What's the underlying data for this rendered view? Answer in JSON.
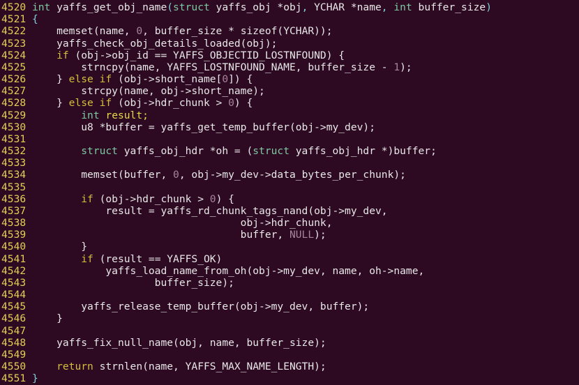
{
  "colors": {
    "background": "#2d0922",
    "line_number": "#e3cf55",
    "keyword": "#d4bf3c",
    "type": "#7ec8a2",
    "number": "#a8849c",
    "match": "#7fd0dc",
    "text": "#e8e8e8"
  },
  "lines": [
    {
      "num": "4520",
      "segs": [
        [
          "ty",
          "int"
        ],
        [
          "t",
          " yaffs_get_obj_name"
        ],
        [
          "c",
          "("
        ],
        [
          "ty",
          "struct"
        ],
        [
          "t",
          " yaffs_obj *obj"
        ],
        [
          "c",
          ","
        ],
        [
          "t",
          " YCHAR *name"
        ],
        [
          "c",
          ","
        ],
        [
          "t",
          " "
        ],
        [
          "ty",
          "int"
        ],
        [
          "t",
          " buffer_size"
        ],
        [
          "c",
          ")"
        ]
      ]
    },
    {
      "num": "4521",
      "segs": [
        [
          "c",
          "{"
        ]
      ]
    },
    {
      "num": "4522",
      "segs": [
        [
          "t",
          "    memset(name, "
        ],
        [
          "n",
          "0"
        ],
        [
          "t",
          ", buffer_size * sizeof(YCHAR));"
        ]
      ]
    },
    {
      "num": "4523",
      "segs": [
        [
          "t",
          "    yaffs_check_obj_details_loaded(obj);"
        ]
      ]
    },
    {
      "num": "4524",
      "segs": [
        [
          "k",
          "    if"
        ],
        [
          "t",
          " (obj->obj_id == YAFFS_OBJECTID_LOSTNFOUND) {"
        ]
      ]
    },
    {
      "num": "4525",
      "segs": [
        [
          "t",
          "        strncpy(name, YAFFS_LOSTNFOUND_NAME, buffer_size - "
        ],
        [
          "n",
          "1"
        ],
        [
          "t",
          ");"
        ]
      ]
    },
    {
      "num": "4526",
      "segs": [
        [
          "t",
          "    } "
        ],
        [
          "k",
          "else if"
        ],
        [
          "t",
          " (obj->short_name["
        ],
        [
          "n",
          "0"
        ],
        [
          "t",
          "]) {"
        ]
      ]
    },
    {
      "num": "4527",
      "segs": [
        [
          "t",
          "        strcpy(name, obj->short_name);"
        ]
      ]
    },
    {
      "num": "4528",
      "segs": [
        [
          "t",
          "    } "
        ],
        [
          "k",
          "else if"
        ],
        [
          "t",
          " (obj->hdr_chunk > "
        ],
        [
          "n",
          "0"
        ],
        [
          "t",
          ") {"
        ]
      ]
    },
    {
      "num": "4529",
      "segs": [
        [
          "ty",
          "        int"
        ],
        [
          "t",
          " "
        ],
        [
          "y",
          "result;"
        ]
      ]
    },
    {
      "num": "4530",
      "segs": [
        [
          "t",
          "        u8 *buffer = yaffs_get_temp_buffer(obj->my_dev);"
        ]
      ]
    },
    {
      "num": "4531",
      "segs": []
    },
    {
      "num": "4532",
      "segs": [
        [
          "ty",
          "        struct"
        ],
        [
          "t",
          " yaffs_obj_hdr *oh = ("
        ],
        [
          "ty",
          "struct"
        ],
        [
          "t",
          " yaffs_obj_hdr *)buffer;"
        ]
      ]
    },
    {
      "num": "4533",
      "segs": []
    },
    {
      "num": "4534",
      "segs": [
        [
          "t",
          "        memset(buffer, "
        ],
        [
          "n",
          "0"
        ],
        [
          "t",
          ", obj->my_dev->data_bytes_per_chunk);"
        ]
      ]
    },
    {
      "num": "4535",
      "segs": []
    },
    {
      "num": "4536",
      "segs": [
        [
          "k",
          "        if"
        ],
        [
          "t",
          " (obj->hdr_chunk > "
        ],
        [
          "n",
          "0"
        ],
        [
          "t",
          ") {"
        ]
      ]
    },
    {
      "num": "4537",
      "segs": [
        [
          "t",
          "            result = yaffs_rd_chunk_tags_nand(obj->my_dev,"
        ]
      ]
    },
    {
      "num": "4538",
      "segs": [
        [
          "t",
          "                                  obj->hdr_chunk,"
        ]
      ]
    },
    {
      "num": "4539",
      "segs": [
        [
          "t",
          "                                  buffer, "
        ],
        [
          "n",
          "NULL"
        ],
        [
          "t",
          ");"
        ]
      ]
    },
    {
      "num": "4540",
      "segs": [
        [
          "t",
          "        }"
        ]
      ]
    },
    {
      "num": "4541",
      "segs": [
        [
          "k",
          "        if"
        ],
        [
          "t",
          " (result == YAFFS_OK)"
        ]
      ]
    },
    {
      "num": "4542",
      "segs": [
        [
          "t",
          "            yaffs_load_name_from_oh(obj->my_dev, name, oh->name,"
        ]
      ]
    },
    {
      "num": "4543",
      "segs": [
        [
          "t",
          "                    buffer_size);"
        ]
      ]
    },
    {
      "num": "4544",
      "segs": []
    },
    {
      "num": "4545",
      "segs": [
        [
          "t",
          "        yaffs_release_temp_buffer(obj->my_dev, buffer);"
        ]
      ]
    },
    {
      "num": "4546",
      "segs": [
        [
          "t",
          "    }"
        ]
      ]
    },
    {
      "num": "4547",
      "segs": []
    },
    {
      "num": "4548",
      "segs": [
        [
          "t",
          "    yaffs_fix_null_name(obj, name, buffer_size);"
        ]
      ]
    },
    {
      "num": "4549",
      "segs": []
    },
    {
      "num": "4550",
      "segs": [
        [
          "k",
          "    return"
        ],
        [
          "t",
          " strnlen(name, YAFFS_MAX_NAME_LENGTH);"
        ]
      ]
    },
    {
      "num": "4551",
      "segs": [
        [
          "c",
          "}"
        ]
      ]
    }
  ]
}
